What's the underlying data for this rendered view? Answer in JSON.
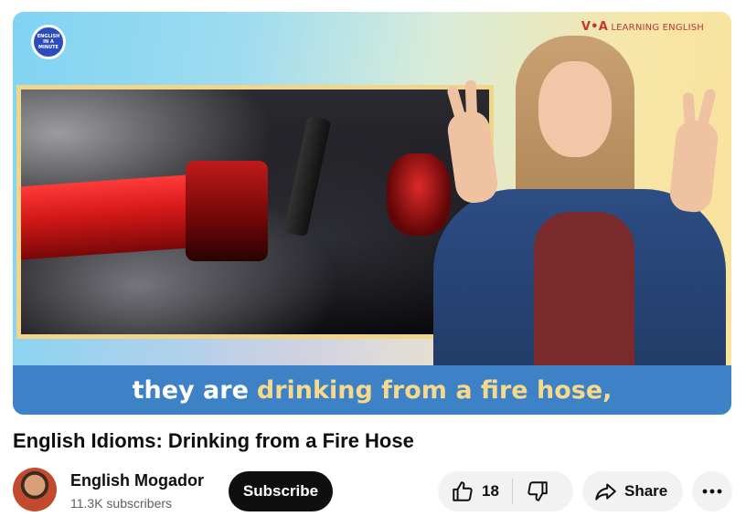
{
  "video": {
    "badge_text": "ENGLISH IN A MINUTE",
    "brand_mark": "V•A",
    "brand_text": "LEARNING ENGLISH",
    "caption_plain": "they are",
    "caption_highlight": "drinking from a fire hose,",
    "caption_highlight_color": "#f7d98b",
    "caption_bar_color": "#3d82c7"
  },
  "title": "English Idioms: Drinking from a Fire Hose",
  "owner": {
    "channel_name": "English Mogador",
    "subscribers": "11.3K subscribers",
    "subscribe_label": "Subscribe"
  },
  "actions": {
    "like_count": "18",
    "like_icon": "thumbs-up-icon",
    "dislike_icon": "thumbs-down-icon",
    "share_label": "Share",
    "share_icon": "share-arrow-icon",
    "more_icon": "more-horizontal-icon"
  }
}
